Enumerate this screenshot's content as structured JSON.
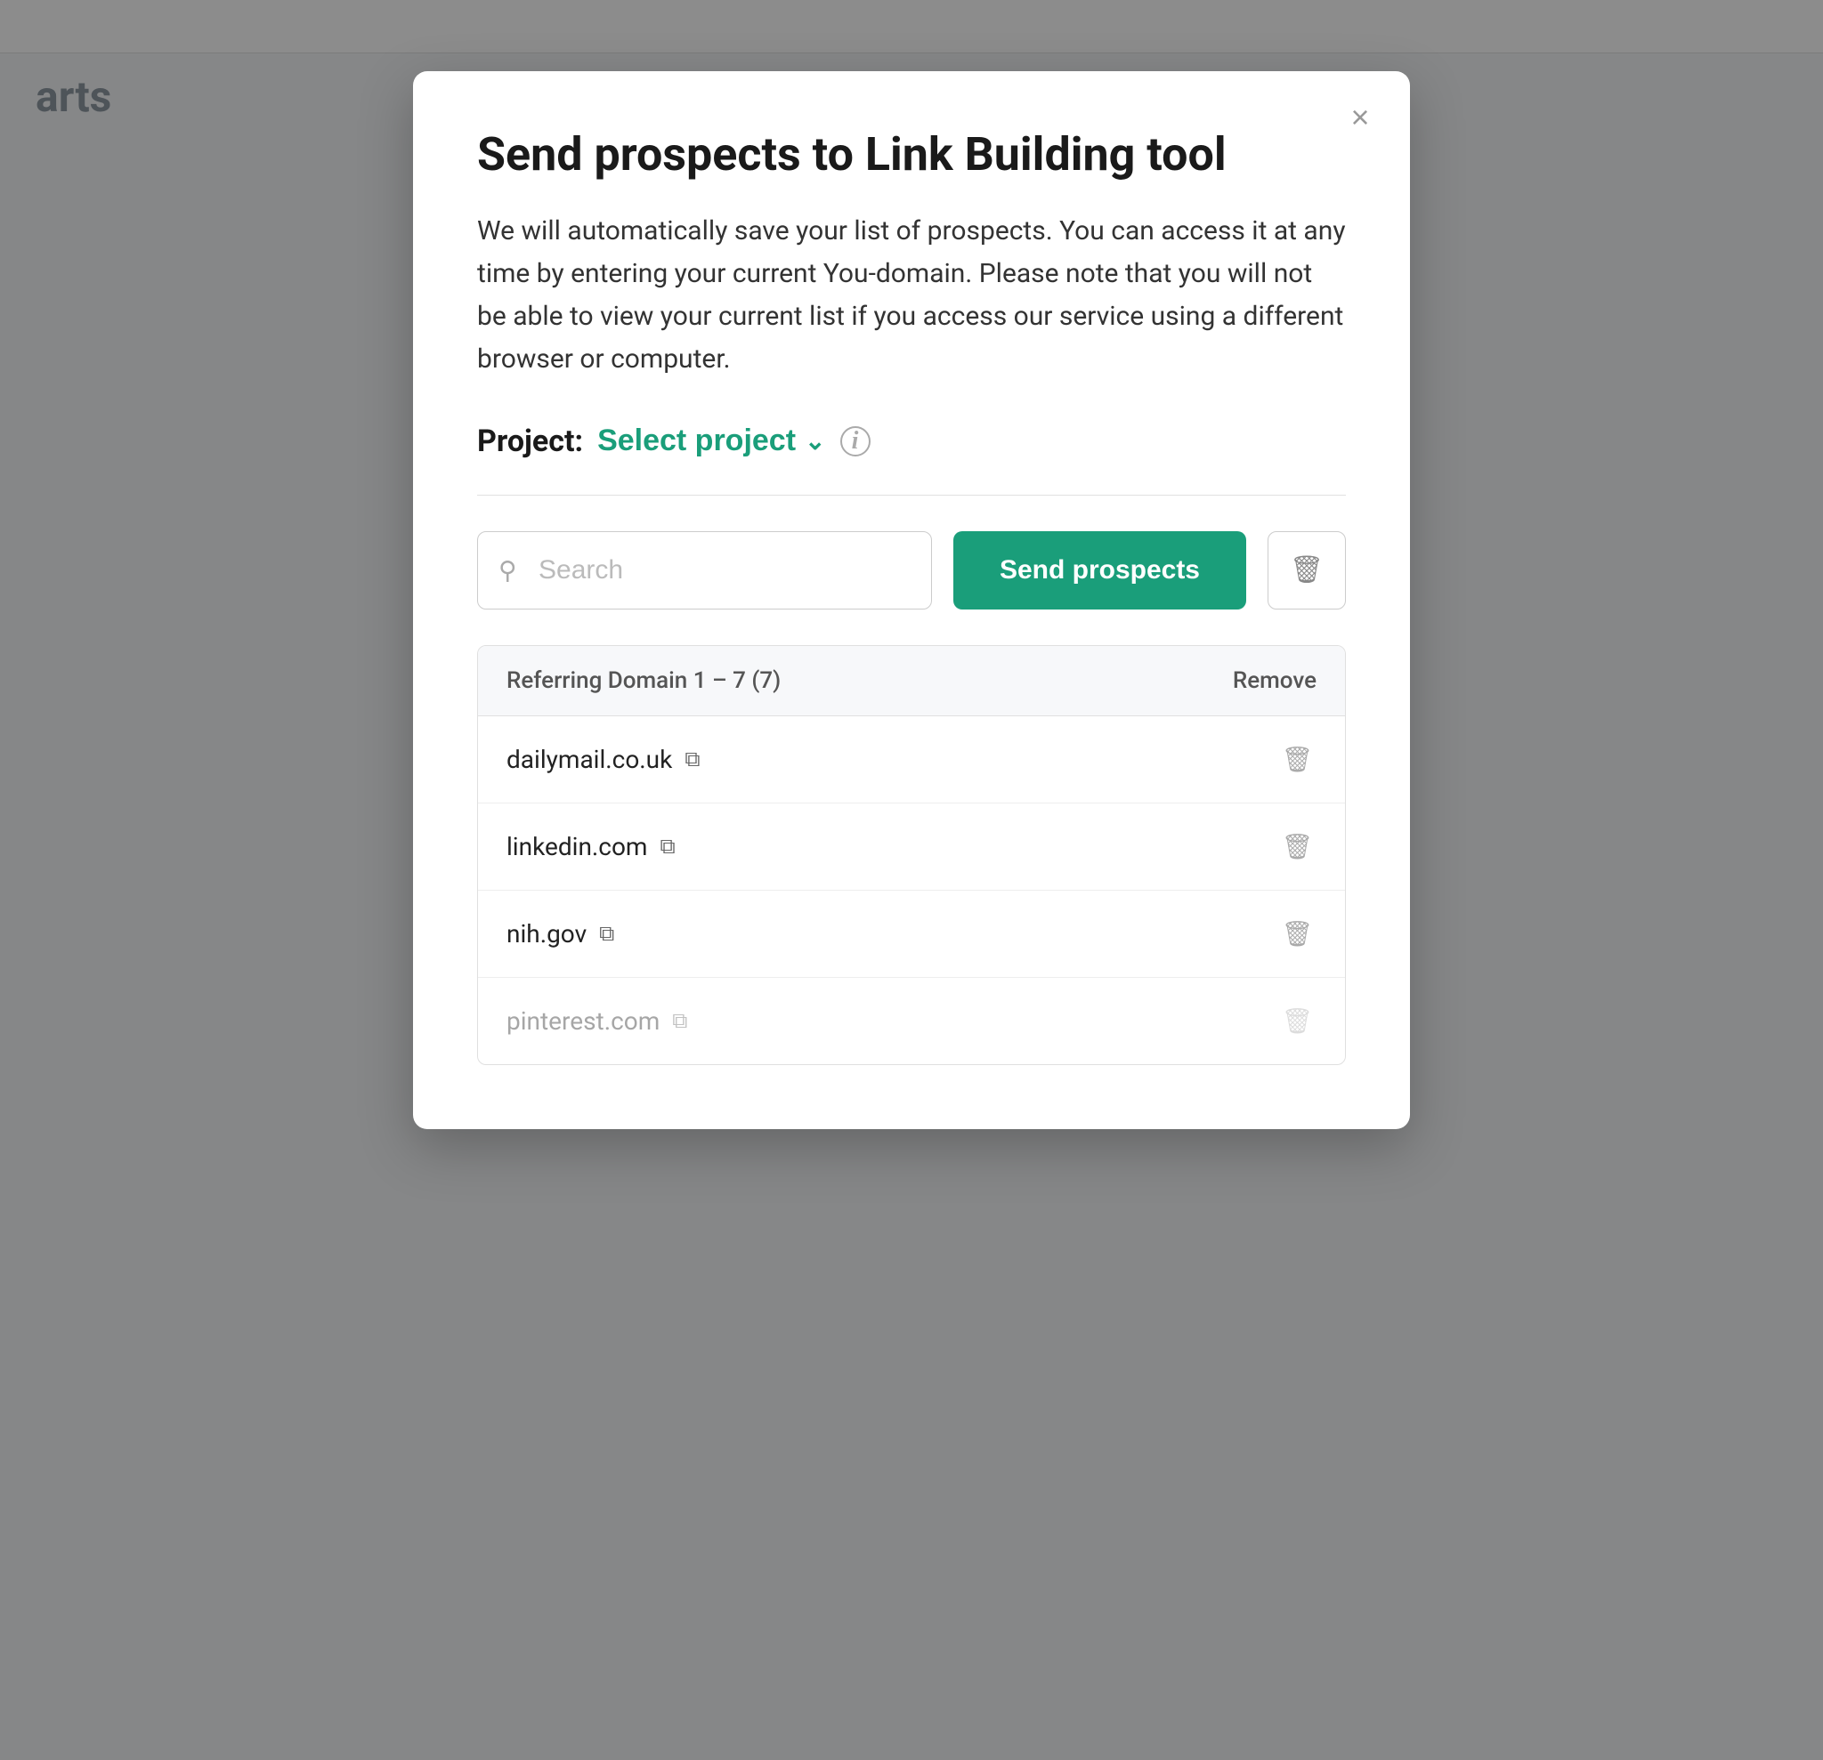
{
  "background": {
    "title": "arts"
  },
  "modal": {
    "title": "Send prospects to Link Building tool",
    "description": "We will automatically save your list of prospects. You can access it at any time by entering your current You-domain. Please note that you will not be able to view your current list if you access our service using a different browser or computer.",
    "project_label": "Project:",
    "project_select_text": "Select project",
    "info_icon_label": "i",
    "close_icon": "×",
    "search_placeholder": "Search",
    "send_button_label": "Send prospects",
    "delete_icon": "🗑",
    "table": {
      "header_domain": "Referring Domain 1 – 7 (7)",
      "header_remove": "Remove",
      "rows": [
        {
          "domain": "dailymail.co.uk",
          "faded": false
        },
        {
          "domain": "linkedin.com",
          "faded": false
        },
        {
          "domain": "nih.gov",
          "faded": false
        },
        {
          "domain": "pinterest.com",
          "faded": true
        }
      ]
    }
  }
}
